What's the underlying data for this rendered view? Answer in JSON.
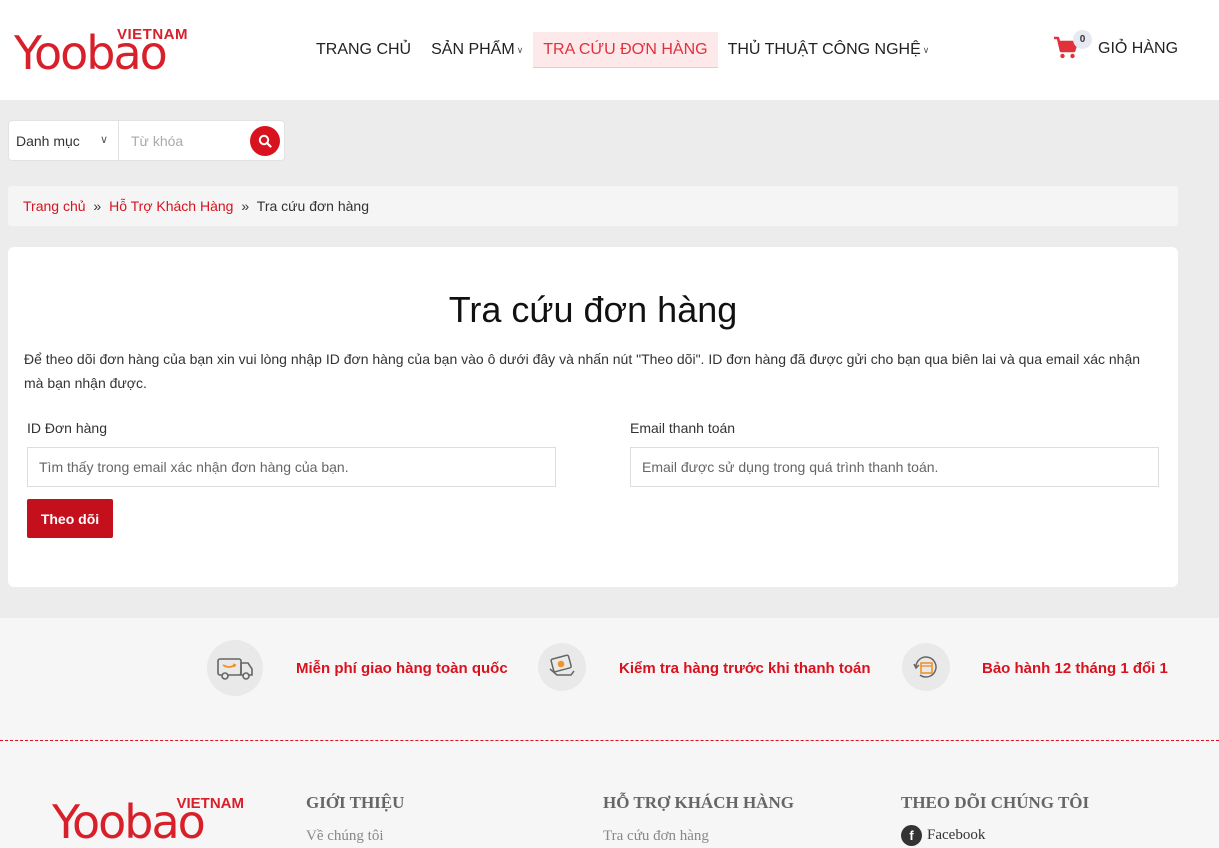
{
  "brand": {
    "top": "VIETNAM",
    "word": "Yoobao"
  },
  "nav": {
    "items": [
      {
        "label": "TRANG CHỦ"
      },
      {
        "label": "SẢN PHẨM",
        "dropdown": true
      },
      {
        "label": "TRA CỨU ĐƠN HÀNG",
        "active": true
      },
      {
        "label": "THỦ THUẬT CÔNG NGHỆ",
        "dropdown": true
      }
    ]
  },
  "cart": {
    "count": "0",
    "label": "GIỎ HÀNG"
  },
  "search": {
    "category": "Danh mục",
    "placeholder": "Từ khóa"
  },
  "breadcrumb": {
    "home": "Trang chủ",
    "support": "Hỗ Trợ Khách Hàng",
    "current": "Tra cứu đơn hàng",
    "sep": "»"
  },
  "tracking": {
    "title": "Tra cứu đơn hàng",
    "description": "Để theo dõi đơn hàng của bạn xin vui lòng nhập ID đơn hàng của bạn vào ô dưới đây và nhấn nút \"Theo dõi\". ID đơn hàng đã được gửi cho bạn qua biên lai và qua email xác nhận mà bạn nhận được.",
    "order_id_label": "ID Đơn hàng",
    "order_id_placeholder": "Tìm thấy trong email xác nhận đơn hàng của bạn.",
    "email_label": "Email thanh toán",
    "email_placeholder": "Email được sử dụng trong quá trình thanh toán.",
    "submit": "Theo dõi"
  },
  "features": [
    {
      "icon": "truck-icon",
      "text": "Miễn phí giao hàng toàn quốc"
    },
    {
      "icon": "money-icon",
      "text": "Kiểm tra hàng trước khi thanh toán"
    },
    {
      "icon": "box-return-icon",
      "text": "Bảo hành 12 tháng 1 đổi 1"
    }
  ],
  "footer": {
    "about": {
      "title": "GIỚI THIỆU",
      "link": "Về chúng tôi"
    },
    "support": {
      "title": "HỖ TRỢ KHÁCH HÀNG",
      "link": "Tra cứu đơn hàng"
    },
    "follow": {
      "title": "THEO DÕI CHÚNG TÔI",
      "link": "Facebook"
    }
  },
  "colors": {
    "accent": "#d9121f",
    "active_bg": "#fde9ea"
  }
}
